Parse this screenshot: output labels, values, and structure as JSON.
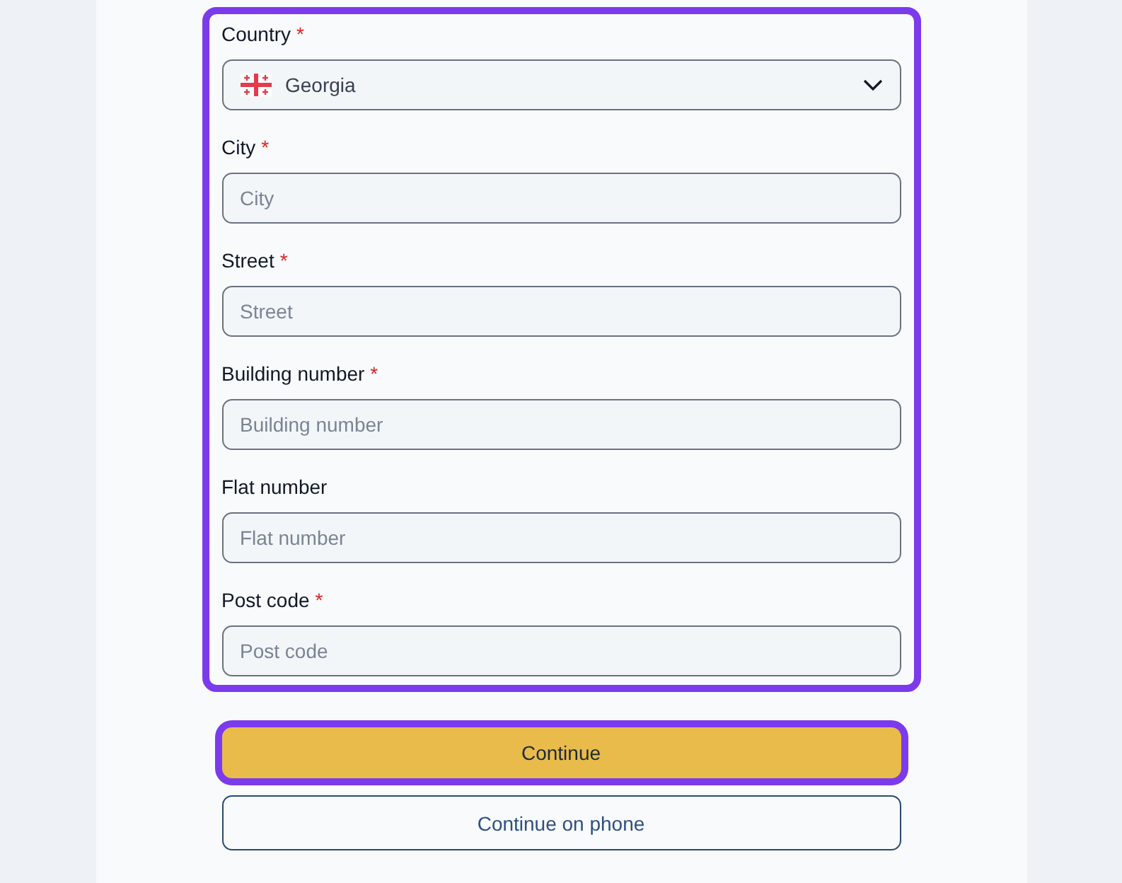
{
  "address_form": {
    "highlighted": true,
    "fields": [
      {
        "kind": "select",
        "label": "Country",
        "required_mark": "*",
        "value": "Georgia"
      },
      {
        "kind": "text",
        "label": "City",
        "required_mark": "*",
        "placeholder": "City"
      },
      {
        "kind": "text",
        "label": "Street",
        "required_mark": "*",
        "placeholder": "Street"
      },
      {
        "kind": "text",
        "label": "Building number",
        "required_mark": "*",
        "placeholder": "Building number"
      },
      {
        "kind": "text",
        "label": "Flat number",
        "placeholder": "Flat number"
      },
      {
        "kind": "text",
        "label": "Post code",
        "required_mark": "*",
        "placeholder": "Post code"
      }
    ]
  },
  "buttons": [
    {
      "kind": "primary",
      "label": "Continue",
      "highlighted": true
    },
    {
      "kind": "outline",
      "label": "Continue on phone",
      "highlighted": false
    }
  ]
}
